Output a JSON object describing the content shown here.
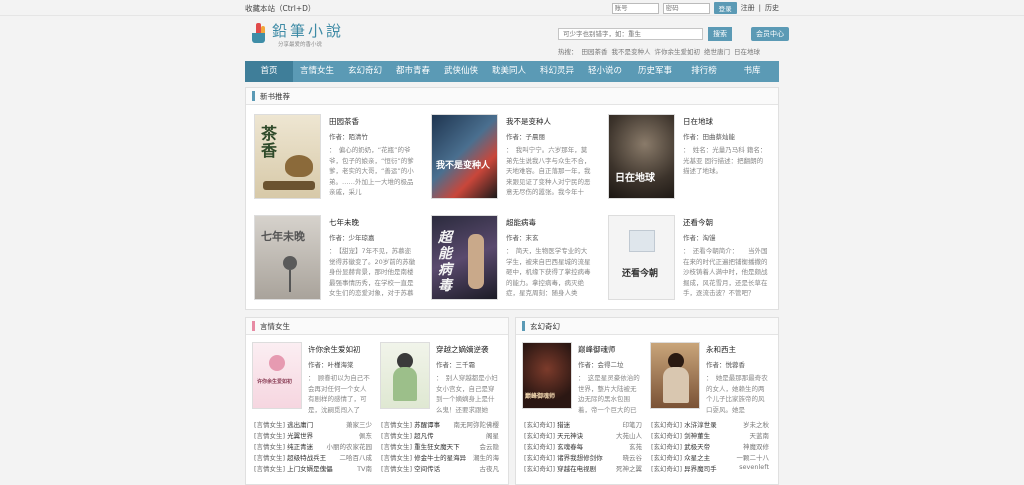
{
  "topbar": {
    "favorite": "收藏本站（Ctrl+D）",
    "account_ph": "账号",
    "password_ph": "密码",
    "login": "登录",
    "register": "注册",
    "divider": "|",
    "history": "历史"
  },
  "logo": {
    "title": "鉛筆小說",
    "slogan": "分享最爱的香小说"
  },
  "search": {
    "placeholder": "可少字也别错字，如：重生",
    "button": "搜索",
    "vip": "会员中心"
  },
  "hot": {
    "label": "热搜：",
    "items": [
      "田园茶香",
      "我不是变种人",
      "许你余生爱如初",
      "绝世唐门",
      "日在地球"
    ]
  },
  "nav": [
    "首页",
    "言情女生",
    "玄幻奇幻",
    "都市青春",
    "武侠仙侠",
    "耽美同人",
    "科幻灵异",
    "轻小说の",
    "历史军事",
    "排行榜",
    "书库"
  ],
  "new_books": {
    "heading": "新书推荐",
    "books": [
      {
        "title": "田园茶香",
        "author": "作者：陌清竹",
        "desc": "：　偏心的奶奶，“花瓶”的爷爷，包子的娘亲，“恒衍”的爹爹，老实的大哥，“善运”的小弟。……外加上一大堆的极品亲戚，采儿"
      },
      {
        "title": "我不是变种人",
        "author": "作者：子晨丽",
        "desc": "：　我叫宁宁。六岁那年，莫弟先生说我八字与众生不合，天地难容。自正落那一年，我来跟见证了变种人对宁民的恶意无尽伤的嚣张。我今年十"
      },
      {
        "title": "日在地球",
        "author": "作者：田曲蔡灿能",
        "desc": "：　姓名：光量乃马科 籍名：光基亚 固行描述：把翻朗的描述了地球。"
      },
      {
        "title": "七年未晚",
        "author": "作者：少年琼嘉",
        "desc": "：　【甜宠】7年不见，苏慕迩觉得苏徽变了。20岁前的苏徽身份显赫背景，那时他是南楼最强事情历秀，在学校一直是女生们的恋爱对象，对于苏慕"
      },
      {
        "title": "超能病毒",
        "author": "作者：末玄",
        "desc": "：　简天，生物医学专业的大学生，被来自巴西星城的流星砸中，机缘下获得了掌控病毒的能力。拿控病毒，病灭绝症，星克周刻：随身人类"
      },
      {
        "title": "还看今朝",
        "author": "作者：淘馒",
        "desc": "：　还看今朝简介：　　当外国在来的时代正遍把铺衡播撒的沙枝铸着人满中时，他是颇战掘成，风花雪月，还是长草在手，逐流击波？不管吧？"
      }
    ]
  },
  "yanqing": {
    "heading": "言情女生",
    "featured": [
      {
        "title": "许你余生爱如初",
        "author": "作者：叶槿海棠",
        "desc": "：　顾眷初以为自己不会再对任何一个女人有剧样的感情了，可是，沈嗣觅闯入了"
      },
      {
        "title": "穿越之嫡嫡逆袭",
        "author": "作者：三千霜",
        "desc": "：　别人穿越都是小妇女小宫女，自己是穿到一个嫡嫡身上是什么鬼！还要求跟她"
      }
    ],
    "list": [
      {
        "cat": "[言情女生]",
        "name": "逃出庸门",
        "author": "萧家三少"
      },
      {
        "cat": "[言情女生]",
        "name": "苏醒谭事",
        "author": "南无阿弥陀佛樱"
      },
      {
        "cat": "[言情女生]",
        "name": "光翼世界",
        "author": "佩东"
      },
      {
        "cat": "[言情女生]",
        "name": "超凡传",
        "author": "阁星"
      },
      {
        "cat": "[言情女生]",
        "name": "纯正青迷",
        "author": "小丽的农家花园"
      },
      {
        "cat": "[言情女生]",
        "name": "重生狂女魔天下",
        "author": "会云隐"
      },
      {
        "cat": "[言情女生]",
        "name": "超级特战兵王",
        "author": "二哈百八成"
      },
      {
        "cat": "[言情女生]",
        "name": "修金牛士的星海异",
        "author": "潮生的海"
      },
      {
        "cat": "[言情女生]",
        "name": "上门女婿是傀儡",
        "author": "TV南"
      },
      {
        "cat": "[言情女生]",
        "name": "空间传话",
        "author": "古夜凡"
      }
    ]
  },
  "xuanhuan": {
    "heading": "玄幻奇幻",
    "featured": [
      {
        "title": "巅峰御魂师",
        "author": "作者：会得二垃",
        "desc": "：　这是星灵豪依治的世界，整片大陆被无边无际的黑水包围着，帝一个巨大的已"
      },
      {
        "title": "永和西主",
        "author": "作者：悦蓉香",
        "desc": "：　她是最那那最奇农的女人，她赖生的两个儿子比家族帝的风口耍风。她是"
      }
    ],
    "list": [
      {
        "cat": "[玄幻奇幻]",
        "name": "猎迷",
        "author": "印笔刀"
      },
      {
        "cat": "[玄幻奇幻]",
        "name": "水浒淳世录",
        "author": "岁未之秋"
      },
      {
        "cat": "[玄幻奇幻]",
        "name": "天元神诀",
        "author": "大苑山人"
      },
      {
        "cat": "[玄幻奇幻]",
        "name": "剑神董生",
        "author": "天蓝南"
      },
      {
        "cat": "[玄幻奇幻]",
        "name": "玄魂春每",
        "author": "玄苑"
      },
      {
        "cat": "[玄幻奇幻]",
        "name": "武极天帝",
        "author": "神魔双修"
      },
      {
        "cat": "[玄幻奇幻]",
        "name": "诸界我想修剑你",
        "author": "晓云谷"
      },
      {
        "cat": "[玄幻奇幻]",
        "name": "众星之主",
        "author": "一颗二十八"
      },
      {
        "cat": "[玄幻奇幻]",
        "name": "穿越在电视剧",
        "author": "死神之翼"
      },
      {
        "cat": "[玄幻奇幻]",
        "name": "异界魔司手",
        "author": "sevenleft"
      }
    ]
  },
  "covers": {
    "c1": "茶香",
    "c2": "我不是变种人",
    "c3": "日在地球",
    "c4": "七年未晚",
    "c5": "超能病毒",
    "c6": "还看今朝",
    "c7": "许你余生爱如初",
    "c8": "巅峰御魂师"
  },
  "colors": {
    "nav": "#5b9ab5",
    "nav_active": "#3f7e99",
    "page_bg": "#f3f3f3"
  }
}
